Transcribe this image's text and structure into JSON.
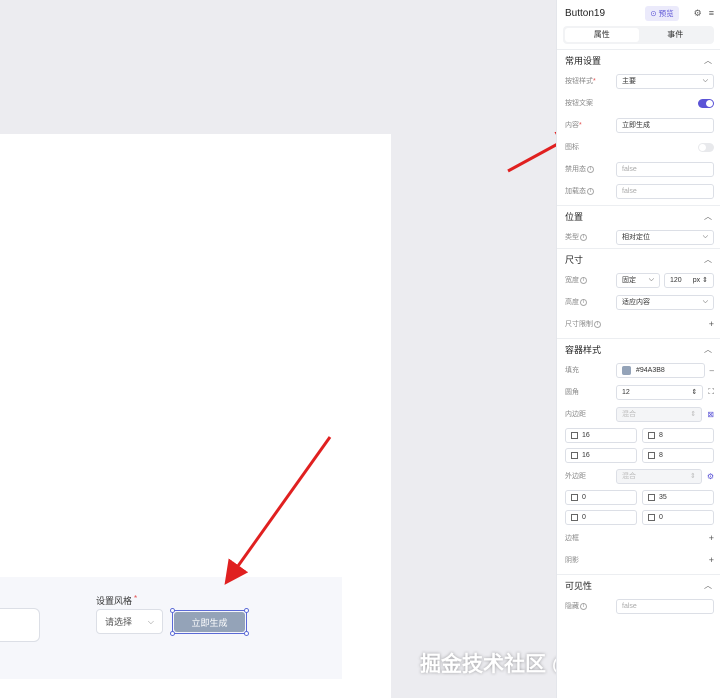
{
  "canvas": {
    "style_label": "设置风格",
    "style_required": "*",
    "select_placeholder": "请选择",
    "select_arrow": "⌵",
    "button_label": "立即生成",
    "button_color": "#94A3B8"
  },
  "watermark": "掘金技术社区 @ 疯狂老包",
  "panel": {
    "title": "Button19",
    "preview_label": "预览",
    "tabs": [
      "属性",
      "事件"
    ],
    "common": {
      "title": "常用设置",
      "button_style_label": "按钮样式",
      "button_style_value": "主要",
      "button_text_label": "按钮文案",
      "content_label": "内容",
      "content_value": "立即生成",
      "icon_label": "图标",
      "disabled_label": "禁用态",
      "disabled_value": "false",
      "loading_label": "加载态",
      "loading_value": "false"
    },
    "position": {
      "title": "位置",
      "type_label": "类型",
      "type_value": "相对定位"
    },
    "size": {
      "title": "尺寸",
      "width_label": "宽度",
      "width_mode": "固定",
      "width_value": "120",
      "width_unit": "px",
      "height_label": "高度",
      "height_value": "适应内容",
      "limit_label": "尺寸限制"
    },
    "container": {
      "title": "容器样式",
      "fill_label": "填充",
      "fill_value": "#94A3B8",
      "radius_label": "圆角",
      "radius_value": "12",
      "padding_label": "内边距",
      "padding_value": "混合",
      "padding_left": "16",
      "padding_top": "8",
      "padding_right": "16",
      "padding_bottom": "8",
      "margin_label": "外边距",
      "margin_value": "混合",
      "margin_left": "0",
      "margin_top": "35",
      "margin_right": "0",
      "margin_bottom": "0",
      "border_label": "边框",
      "shadow_label": "阴影"
    },
    "visibility": {
      "title": "可见性",
      "hidden_label": "隐藏",
      "hidden_value": "false"
    }
  }
}
